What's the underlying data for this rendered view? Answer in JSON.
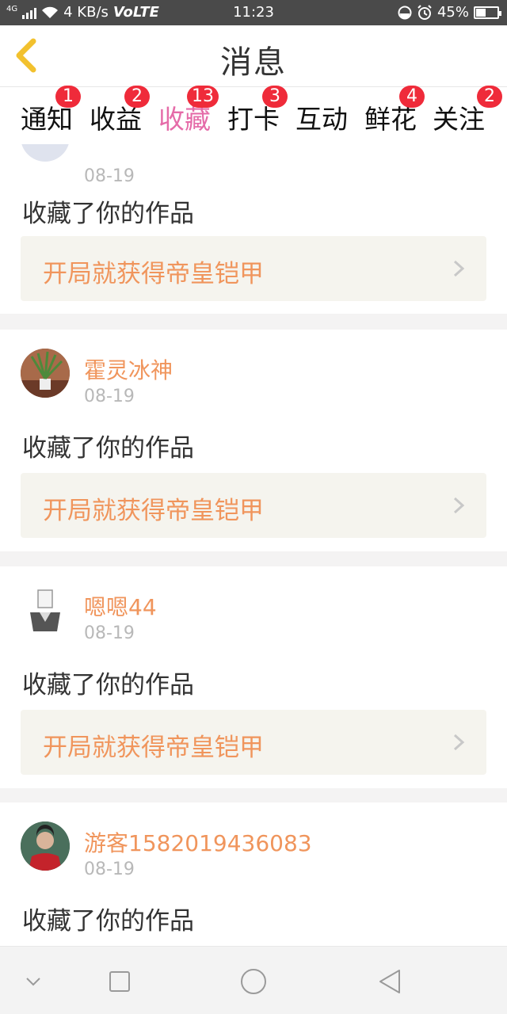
{
  "status_bar": {
    "network": "4G",
    "speed": "4 KB/s",
    "volte": "VoLTE",
    "time": "11:23",
    "battery": "45%",
    "battery_level": 0.45
  },
  "header": {
    "title": "消息"
  },
  "tabs": [
    {
      "label": "通知",
      "badge": "1"
    },
    {
      "label": "收益",
      "badge": "2"
    },
    {
      "label": "收藏",
      "badge": "13",
      "active": true
    },
    {
      "label": "打卡",
      "badge": "3"
    },
    {
      "label": "互动",
      "badge": ""
    },
    {
      "label": "鲜花",
      "badge": "4"
    },
    {
      "label": "关注",
      "badge": "2"
    }
  ],
  "items": [
    {
      "user": "",
      "date": "08-19",
      "action": "收藏了你的作品",
      "work": "开局就获得帝皇铠甲"
    },
    {
      "user": "霍灵冰神",
      "date": "08-19",
      "action": "收藏了你的作品",
      "work": "开局就获得帝皇铠甲"
    },
    {
      "user": "嗯嗯44",
      "date": "08-19",
      "action": "收藏了你的作品",
      "work": "开局就获得帝皇铠甲"
    },
    {
      "user": "游客1582019436083",
      "date": "08-19",
      "action": "收藏了你的作品",
      "work": ""
    }
  ],
  "colors": {
    "accent": "#e56ba8",
    "username": "#f0955c",
    "badge": "#ef2b3a",
    "back_icon": "#f2c12e"
  },
  "icons": {
    "back": "chevron-left-icon",
    "arrow": "chevron-right-icon",
    "nav": [
      "chevron-down-icon",
      "square-icon",
      "circle-icon",
      "triangle-back-icon"
    ]
  }
}
